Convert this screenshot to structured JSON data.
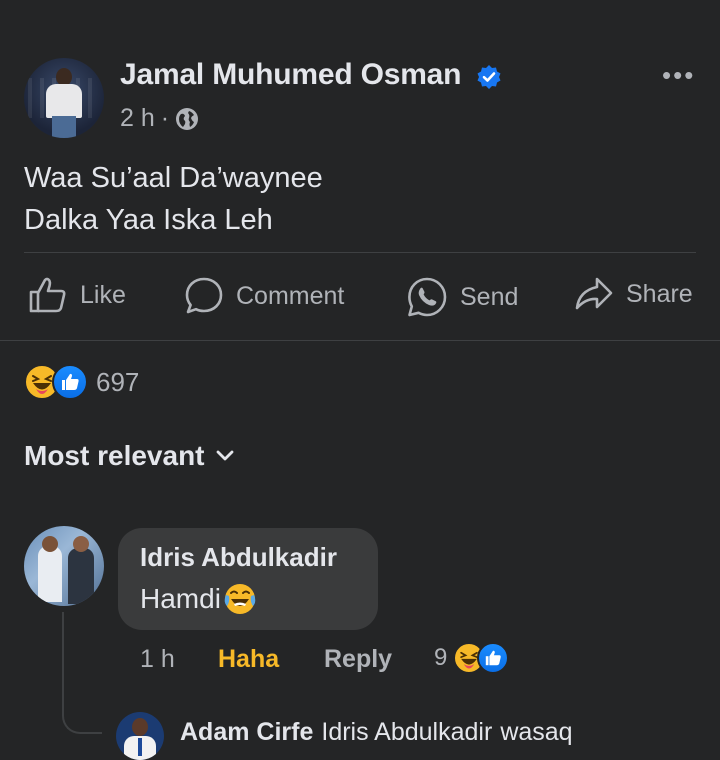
{
  "post": {
    "author": "Jamal Muhumed Osman",
    "time": "2 h",
    "separator": "·",
    "lines": [
      "Waa Su’aal Da’waynee",
      "Dalka Yaa Iska Leh"
    ]
  },
  "actions": {
    "like": "Like",
    "comment": "Comment",
    "send": "Send",
    "share": "Share"
  },
  "reactions": {
    "count": "697",
    "types": [
      "haha",
      "like"
    ]
  },
  "sort": {
    "label": "Most relevant"
  },
  "comment": {
    "author": "Idris Abdulkadir",
    "text": "Hamdi",
    "emoji": "face-with-tears-of-joy",
    "time": "1 h",
    "reaction_label": "Haha",
    "reply_label": "Reply",
    "reaction_count": "9"
  },
  "reply": {
    "author": "Adam Cirfe",
    "mention": "Idris Abdulkadir",
    "text": "wasaq"
  },
  "colors": {
    "background": "#242526",
    "text": "#e4e6eb",
    "muted": "#b0b3b8",
    "haha_accent": "#f7b928",
    "verified_blue": "#1877f2",
    "bubble": "#3a3b3c"
  }
}
